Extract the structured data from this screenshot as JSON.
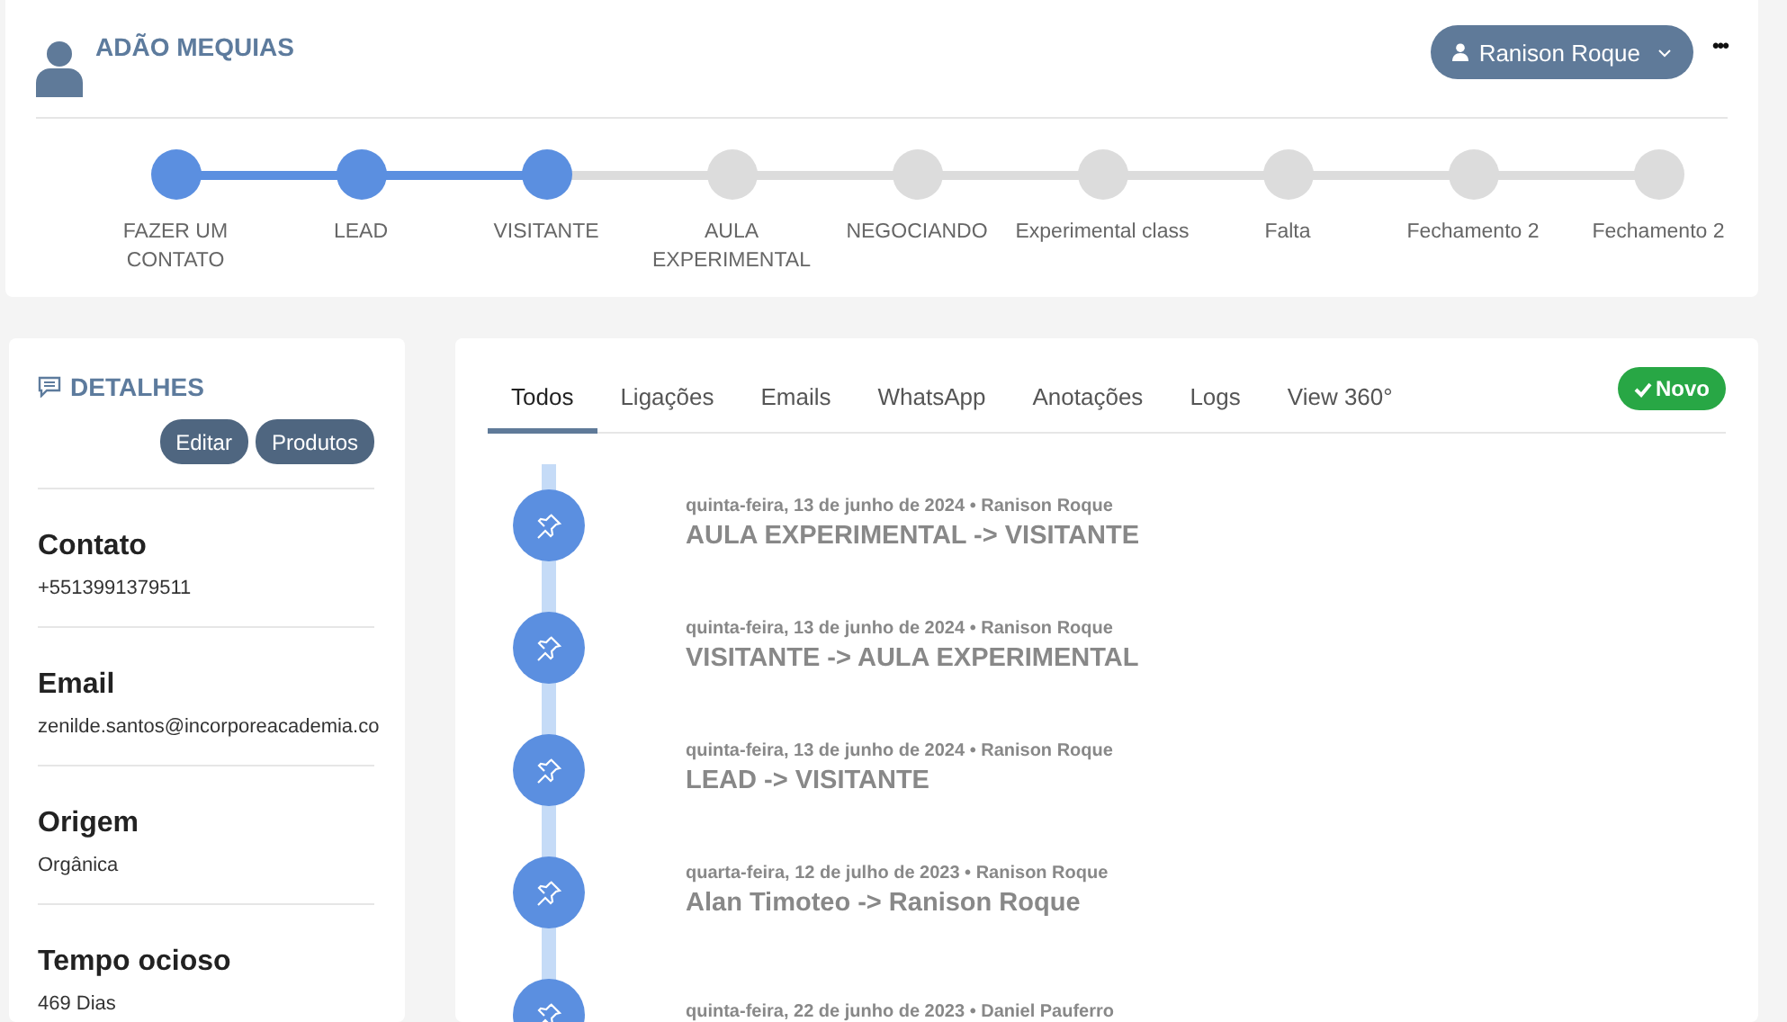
{
  "contact": {
    "name": "ADÃO MEQUIAS",
    "owner_button": "Ranison Roque",
    "more": "•••"
  },
  "stages": [
    {
      "label": "FAZER UM CONTATO",
      "completed": true
    },
    {
      "label": "LEAD",
      "completed": true
    },
    {
      "label": "VISITANTE",
      "completed": true
    },
    {
      "label": "AULA EXPERIMENTAL",
      "completed": false
    },
    {
      "label": "NEGOCIANDO",
      "completed": false
    },
    {
      "label": "Experimental class",
      "completed": false
    },
    {
      "label": "Falta",
      "completed": false
    },
    {
      "label": "Fechamento 2",
      "completed": false
    },
    {
      "label": "Fechamento 2",
      "completed": false
    }
  ],
  "details": {
    "title": "DETALHES",
    "buttons": [
      "Editar",
      "Produtos"
    ],
    "fields": [
      {
        "label": "Contato",
        "value": "+5513991379511"
      },
      {
        "label": "Email",
        "value": "zenilde.santos@incorporeacademia.co"
      },
      {
        "label": "Origem",
        "value": "Orgânica"
      },
      {
        "label": "Tempo ocioso",
        "value": "469 Dias"
      }
    ]
  },
  "tabs": [
    {
      "label": "Todos",
      "selected": true
    },
    {
      "label": "Ligações",
      "selected": false
    },
    {
      "label": "Emails",
      "selected": false
    },
    {
      "label": "WhatsApp",
      "selected": false
    },
    {
      "label": "Anotações",
      "selected": false
    },
    {
      "label": "Logs",
      "selected": false
    },
    {
      "label": "View 360°",
      "selected": false
    }
  ],
  "new_button": "Novo",
  "timeline": [
    {
      "meta": "quinta-feira, 13 de junho de 2024 • Ranison Roque",
      "title": "AULA EXPERIMENTAL -> VISITANTE"
    },
    {
      "meta": "quinta-feira, 13 de junho de 2024 • Ranison Roque",
      "title": "VISITANTE -> AULA EXPERIMENTAL"
    },
    {
      "meta": "quinta-feira, 13 de junho de 2024 • Ranison Roque",
      "title": "LEAD -> VISITANTE"
    },
    {
      "meta": "quarta-feira, 12 de julho de 2023 • Ranison Roque",
      "title": "Alan Timoteo -> Ranison Roque"
    },
    {
      "meta": "quinta-feira, 22 de junho de 2023 • Daniel Pauferro"
    }
  ]
}
